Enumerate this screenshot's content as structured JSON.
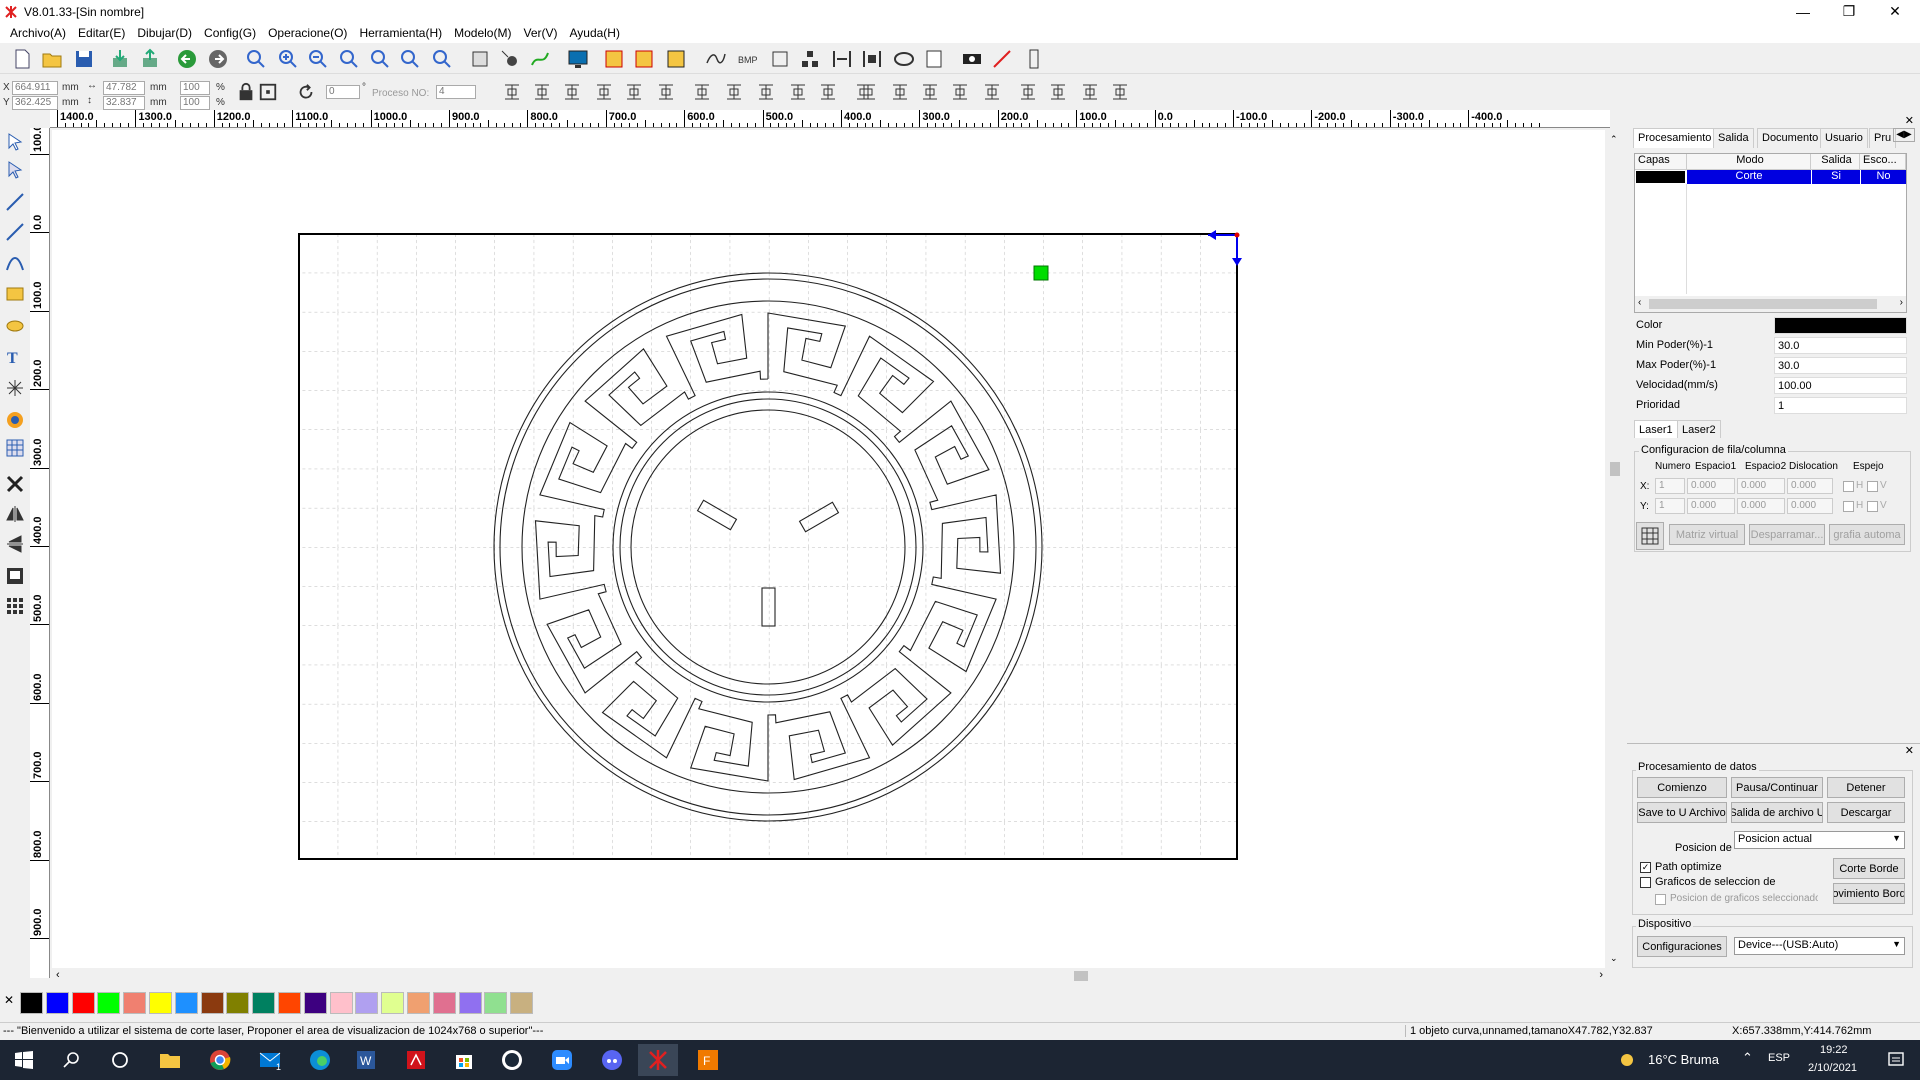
{
  "window": {
    "title": "V8.01.33-[Sin nombre]"
  },
  "menu": [
    "Archivo(A)",
    "Editar(E)",
    "Dibujar(D)",
    "Config(G)",
    "Operacione(O)",
    "Herramienta(H)",
    "Modelo(M)",
    "Ver(V)",
    "Ayuda(H)"
  ],
  "coords": {
    "x_label": "X",
    "x_value": "664.911",
    "x_unit": "mm",
    "y_label": "Y",
    "y_value": "362.425",
    "y_unit": "mm",
    "w_value": "47.782",
    "w_unit": "mm",
    "h_value": "32.837",
    "h_unit": "mm",
    "sx_value": "100",
    "sx_unit": "%",
    "sy_value": "100",
    "sy_unit": "%",
    "rotate_value": "0",
    "rotate_unit": "°",
    "process_label": "Proceso NO:",
    "process_value": "4"
  },
  "ruler": {
    "h_labels": [
      "1400.0",
      "1300.0",
      "1200.0",
      "1100.0",
      "1000.0",
      "900.0",
      "800.0",
      "700.0",
      "600.0",
      "500.0",
      "400.0",
      "300.0",
      "200.0",
      "100.0",
      "0.0",
      "-100.0",
      "-200.0",
      "-300.0",
      "-400.0"
    ],
    "v_labels": [
      "100.0",
      "0.0",
      "100.0",
      "200.0",
      "300.0",
      "400.0",
      "500.0",
      "600.0",
      "700.0",
      "800.0",
      "900.0"
    ]
  },
  "palette": [
    "#000000",
    "#0000ff",
    "#ff0000",
    "#00ff00",
    "#f08070",
    "#ffff00",
    "#1e90ff",
    "#8b3a0f",
    "#808000",
    "#008060",
    "#ff4500",
    "#3d0080",
    "#ffc0cb",
    "#b0a0f0",
    "#e0ff90",
    "#f0a070",
    "#e07090",
    "#9070f0",
    "#90e090",
    "#c8b080"
  ],
  "status": {
    "message": "--- \"Bienvenido a utilizar el sistema de corte laser, Proponer el area de visualizacion de 1024x768 o superior\"---",
    "selection": "1 objeto curva,unnamed,tamanoX47.782,Y32.837",
    "position": "X:657.338mm,Y:414.762mm"
  },
  "panel": {
    "tabs": [
      "Procesamiento",
      "Salida",
      "Documento",
      "Usuario",
      "Pru"
    ],
    "layer_headers": [
      "Capas",
      "Modo",
      "Salida",
      "Esco..."
    ],
    "layer_row": {
      "mode": "Corte",
      "output": "Si",
      "hide": "No",
      "color": "#000000"
    },
    "props": [
      {
        "key": "Color",
        "value": ""
      },
      {
        "key": "Min Poder(%)-1",
        "value": "30.0"
      },
      {
        "key": "Max Poder(%)-1",
        "value": "30.0"
      },
      {
        "key": "Velocidad(mm/s)",
        "value": "100.00"
      },
      {
        "key": "Prioridad",
        "value": "1"
      }
    ],
    "laser_tabs": [
      "Laser1",
      "Laser2"
    ],
    "array": {
      "title": "Configuracion de fila/columna",
      "headers": [
        "Numero",
        "Espacio1",
        "Espacio2",
        "Dislocation",
        "Espejo"
      ],
      "x_label": "X:",
      "y_label": "Y:",
      "x_values": [
        "1",
        "0.000",
        "0.000",
        "0.000"
      ],
      "y_values": [
        "1",
        "0.000",
        "0.000",
        "0.000"
      ],
      "mirror_h": "H",
      "mirror_v": "V",
      "buttons": [
        "Matriz virtual",
        "Desparramar...",
        "grafia automa"
      ]
    },
    "data_processing": {
      "title": "Procesamiento de datos",
      "start": "Comienzo",
      "pause": "Pausa/Continuar",
      "stop": "Detener",
      "save_u": "Save to U Archivo",
      "output_u": "Salida de archivo U",
      "download": "Descargar",
      "position_label": "Posicion de",
      "position_value": "Posicion actual",
      "path_optimize": "Path optimize",
      "selected_graphics": "Graficos de seleccion de",
      "selected_position": "Posicion de graficos seleccionado",
      "cut_border": "Corte Borde",
      "move_border": "ovimiento Bord"
    },
    "device": {
      "title": "Dispositivo",
      "config": "Configuraciones",
      "device_value": "Device---(USB:Auto)"
    }
  },
  "taskbar": {
    "weather": "16°C  Bruma",
    "lang": "ESP",
    "time": "19:22",
    "date": "2/10/2021",
    "mail_badge": "1"
  }
}
